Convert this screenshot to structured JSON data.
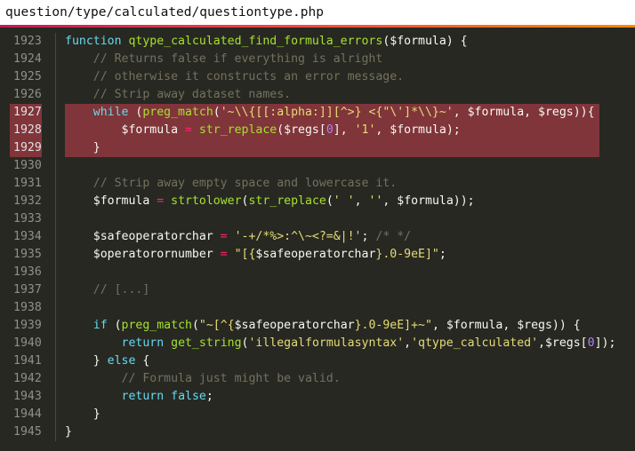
{
  "window": {
    "file_path": "question/type/calculated/questiontype.php"
  },
  "colors": {
    "background": "#272822",
    "highlight": "#80353a",
    "keyword": "#66d9ef",
    "function": "#a6e22e",
    "string": "#e6db74",
    "comment": "#75715e",
    "number": "#ae81ff",
    "operator": "#f92672",
    "accent_gradient": [
      "#c2185b",
      "#ff4f3a",
      "#ff8a00"
    ]
  },
  "editor": {
    "highlighted_lines": [
      1927,
      1928,
      1929
    ],
    "lines": [
      {
        "number": "1923",
        "highlight": false,
        "tokens": [
          {
            "t": "kw",
            "v": "function"
          },
          {
            "t": "",
            "v": " "
          },
          {
            "t": "fn",
            "v": "qtype_calculated_find_formula_errors"
          },
          {
            "t": "",
            "v": "($formula) {"
          }
        ]
      },
      {
        "number": "1924",
        "highlight": false,
        "tokens": [
          {
            "t": "",
            "v": "    "
          },
          {
            "t": "cm",
            "v": "// Returns false if everything is alright"
          }
        ]
      },
      {
        "number": "1925",
        "highlight": false,
        "tokens": [
          {
            "t": "",
            "v": "    "
          },
          {
            "t": "cm",
            "v": "// otherwise it constructs an error message."
          }
        ]
      },
      {
        "number": "1926",
        "highlight": false,
        "tokens": [
          {
            "t": "",
            "v": "    "
          },
          {
            "t": "cm",
            "v": "// Strip away dataset names."
          }
        ]
      },
      {
        "number": "1927",
        "highlight": true,
        "tokens": [
          {
            "t": "",
            "v": "    "
          },
          {
            "t": "kw",
            "v": "while"
          },
          {
            "t": "",
            "v": " ("
          },
          {
            "t": "fn",
            "v": "preg_match"
          },
          {
            "t": "",
            "v": "("
          },
          {
            "t": "str",
            "v": "'~\\\\{[[:alpha:]][^>} <{\"\\']*\\\\}~'"
          },
          {
            "t": "",
            "v": ", $formula, $regs)){"
          }
        ]
      },
      {
        "number": "1928",
        "highlight": true,
        "tokens": [
          {
            "t": "",
            "v": "        $formula "
          },
          {
            "t": "op",
            "v": "="
          },
          {
            "t": "",
            "v": " "
          },
          {
            "t": "fn",
            "v": "str_replace"
          },
          {
            "t": "",
            "v": "($regs["
          },
          {
            "t": "num",
            "v": "0"
          },
          {
            "t": "",
            "v": "], "
          },
          {
            "t": "str",
            "v": "'1'"
          },
          {
            "t": "",
            "v": ", $formula);"
          }
        ]
      },
      {
        "number": "1929",
        "highlight": true,
        "tokens": [
          {
            "t": "",
            "v": "    }"
          }
        ]
      },
      {
        "number": "1930",
        "highlight": false,
        "tokens": []
      },
      {
        "number": "1931",
        "highlight": false,
        "tokens": [
          {
            "t": "",
            "v": "    "
          },
          {
            "t": "cm",
            "v": "// Strip away empty space and lowercase it."
          }
        ]
      },
      {
        "number": "1932",
        "highlight": false,
        "tokens": [
          {
            "t": "",
            "v": "    $formula "
          },
          {
            "t": "op",
            "v": "="
          },
          {
            "t": "",
            "v": " "
          },
          {
            "t": "fn",
            "v": "strtolower"
          },
          {
            "t": "",
            "v": "("
          },
          {
            "t": "fn",
            "v": "str_replace"
          },
          {
            "t": "",
            "v": "("
          },
          {
            "t": "str",
            "v": "' '"
          },
          {
            "t": "",
            "v": ", "
          },
          {
            "t": "str",
            "v": "''"
          },
          {
            "t": "",
            "v": ", $formula));"
          }
        ]
      },
      {
        "number": "1933",
        "highlight": false,
        "tokens": []
      },
      {
        "number": "1934",
        "highlight": false,
        "tokens": [
          {
            "t": "",
            "v": "    $safeoperatorchar "
          },
          {
            "t": "op",
            "v": "="
          },
          {
            "t": "",
            "v": " "
          },
          {
            "t": "str",
            "v": "'-+/*%>:^\\~<?=&|!'"
          },
          {
            "t": "",
            "v": "; "
          },
          {
            "t": "cm",
            "v": "/* */"
          }
        ]
      },
      {
        "number": "1935",
        "highlight": false,
        "tokens": [
          {
            "t": "",
            "v": "    $operatorornumber "
          },
          {
            "t": "op",
            "v": "="
          },
          {
            "t": "",
            "v": " "
          },
          {
            "t": "str",
            "v": "\"[{"
          },
          {
            "t": "",
            "v": "$safeoperatorchar"
          },
          {
            "t": "str",
            "v": "}.0-9eE]\""
          },
          {
            "t": "",
            "v": ";"
          }
        ]
      },
      {
        "number": "1936",
        "highlight": false,
        "tokens": []
      },
      {
        "number": "1937",
        "highlight": false,
        "tokens": [
          {
            "t": "",
            "v": "    "
          },
          {
            "t": "cm",
            "v": "// [...]"
          }
        ]
      },
      {
        "number": "1938",
        "highlight": false,
        "tokens": []
      },
      {
        "number": "1939",
        "highlight": false,
        "tokens": [
          {
            "t": "",
            "v": "    "
          },
          {
            "t": "kw",
            "v": "if"
          },
          {
            "t": "",
            "v": " ("
          },
          {
            "t": "fn",
            "v": "preg_match"
          },
          {
            "t": "",
            "v": "("
          },
          {
            "t": "str",
            "v": "\"~[^{"
          },
          {
            "t": "",
            "v": "$safeoperatorchar"
          },
          {
            "t": "str",
            "v": "}.0-9eE]+~\""
          },
          {
            "t": "",
            "v": ", $formula, $regs)) {"
          }
        ]
      },
      {
        "number": "1940",
        "highlight": false,
        "tokens": [
          {
            "t": "",
            "v": "        "
          },
          {
            "t": "kw",
            "v": "return"
          },
          {
            "t": "",
            "v": " "
          },
          {
            "t": "fn",
            "v": "get_string"
          },
          {
            "t": "",
            "v": "("
          },
          {
            "t": "str",
            "v": "'illegalformulasyntax'"
          },
          {
            "t": "",
            "v": ","
          },
          {
            "t": "str",
            "v": "'qtype_calculated'"
          },
          {
            "t": "",
            "v": ",$regs["
          },
          {
            "t": "num",
            "v": "0"
          },
          {
            "t": "",
            "v": "]);"
          }
        ]
      },
      {
        "number": "1941",
        "highlight": false,
        "tokens": [
          {
            "t": "",
            "v": "    } "
          },
          {
            "t": "kw",
            "v": "else"
          },
          {
            "t": "",
            "v": " {"
          }
        ]
      },
      {
        "number": "1942",
        "highlight": false,
        "tokens": [
          {
            "t": "",
            "v": "        "
          },
          {
            "t": "cm",
            "v": "// Formula just might be valid."
          }
        ]
      },
      {
        "number": "1943",
        "highlight": false,
        "tokens": [
          {
            "t": "",
            "v": "        "
          },
          {
            "t": "kw",
            "v": "return"
          },
          {
            "t": "",
            "v": " "
          },
          {
            "t": "kw",
            "v": "false"
          },
          {
            "t": "",
            "v": ";"
          }
        ]
      },
      {
        "number": "1944",
        "highlight": false,
        "tokens": [
          {
            "t": "",
            "v": "    }"
          }
        ]
      },
      {
        "number": "1945",
        "highlight": false,
        "tokens": [
          {
            "t": "",
            "v": "}"
          }
        ]
      }
    ]
  }
}
